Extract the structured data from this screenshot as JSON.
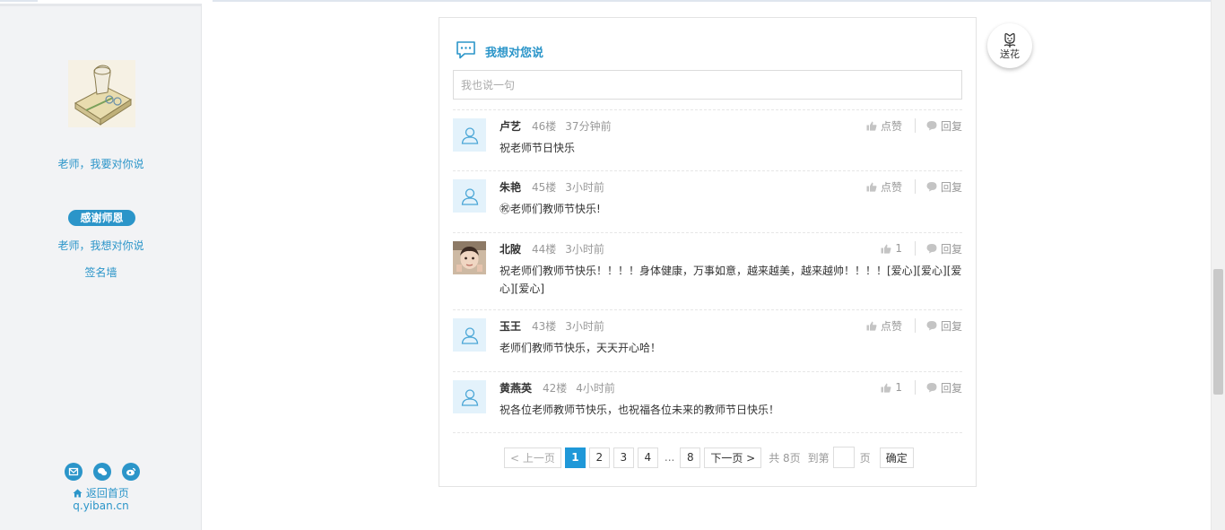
{
  "sidebar": {
    "link_speak": "老师，我要对你说",
    "badge": "感谢师恩",
    "link_think": "老师，我想对你说",
    "link_wall": "签名墙",
    "share_icons": [
      "mail-icon",
      "wechat-icon",
      "weibo-icon"
    ],
    "home_label": "返回首页",
    "site": "q.yiban.cn"
  },
  "panel": {
    "title": "我想对您说",
    "input_placeholder": "我也说一句",
    "like_label": "点赞",
    "reply_label": "回复"
  },
  "comments": [
    {
      "user": "卢艺",
      "floor": "46楼",
      "time": "37分钟前",
      "text": "祝老师节日快乐",
      "likes": "点赞",
      "reply": "回复",
      "avatar": "default-avatar-icon"
    },
    {
      "user": "朱艳",
      "floor": "45楼",
      "time": "3小时前",
      "text": "㊗老师们教师节快乐!",
      "likes": "点赞",
      "reply": "回复",
      "avatar": "default-avatar-icon"
    },
    {
      "user": "北陂",
      "floor": "44楼",
      "time": "3小时前",
      "text": "祝老师们教师节快乐！！！！身体健康，万事如意，越来越美，越来越帅！！！！[爱心][爱心][爱心][爱心]",
      "likes": "1",
      "reply": "回复",
      "avatar": "photo-avatar"
    },
    {
      "user": "玉王",
      "floor": "43楼",
      "time": "3小时前",
      "text": "老师们教师节快乐，天天开心哈！",
      "likes": "点赞",
      "reply": "回复",
      "avatar": "default-avatar-icon"
    },
    {
      "user": "黄燕英",
      "floor": "42楼",
      "time": "4小时前",
      "text": "祝各位老师教师节快乐，也祝福各位未来的教师节日快乐！",
      "likes": "1",
      "reply": "回复",
      "avatar": "default-avatar-icon"
    }
  ],
  "pager": {
    "prev": "< 上一页",
    "pages": [
      "1",
      "2",
      "3",
      "4"
    ],
    "dots": "...",
    "last": "8",
    "next": "下一页 >",
    "total": "共 8页",
    "goto": "到第",
    "unit": "页",
    "confirm": "确定",
    "current": "1"
  },
  "flower": {
    "label": "送花",
    "icon": "flower-icon"
  },
  "colors": {
    "accent": "#2b95c9",
    "active_page": "#1f98d8"
  }
}
